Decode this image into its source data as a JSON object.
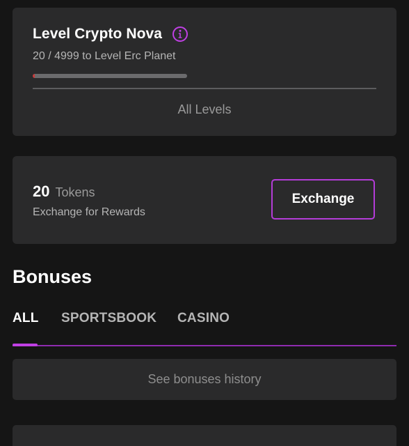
{
  "level": {
    "title": "Level Crypto Nova",
    "info_icon": "info-icon",
    "progress_text": "20 / 4999 to Level Erc Planet",
    "progress_fraction": 0.004,
    "all_levels_label": "All Levels"
  },
  "tokens": {
    "count": "20",
    "unit": "Tokens",
    "subtitle": "Exchange for Rewards",
    "exchange_label": "Exchange"
  },
  "bonuses": {
    "heading": "Bonuses",
    "tabs": [
      {
        "label": "ALL",
        "active": true
      },
      {
        "label": "SPORTSBOOK",
        "active": false
      },
      {
        "label": "CASINO",
        "active": false
      }
    ],
    "history_label": "See bonuses history"
  },
  "colors": {
    "background": "#151515",
    "card": "#2a2a2b",
    "accent": "#b43cd8",
    "progress_fill": "#c93a3a"
  }
}
